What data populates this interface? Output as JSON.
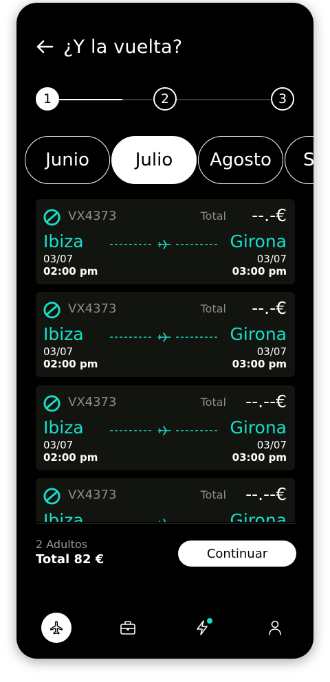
{
  "header": {
    "title": "¿Y la vuelta?",
    "back_icon": "arrow-left-icon"
  },
  "stepper": {
    "steps": [
      "1",
      "2",
      "3"
    ],
    "current_step": 1
  },
  "months": {
    "items": [
      "Junio",
      "Julio",
      "Agosto",
      "S"
    ],
    "selected": "Julio"
  },
  "flights": [
    {
      "code": "VX4373",
      "total_label": "Total",
      "price": "--.-€",
      "from": "Ibiza",
      "to": "Girona",
      "date_from": "03/07",
      "date_to": "03/07",
      "time_from": "02:00 pm",
      "time_to": "03:00 pm"
    },
    {
      "code": "VX4373",
      "total_label": "Total",
      "price": "--.-€",
      "from": "Ibiza",
      "to": "Girona",
      "date_from": "03/07",
      "date_to": "03/07",
      "time_from": "02:00 pm",
      "time_to": "03:00 pm"
    },
    {
      "code": "VX4373",
      "total_label": "Total",
      "price": "--.--€",
      "from": "Ibiza",
      "to": "Girona",
      "date_from": "03/07",
      "date_to": "03/07",
      "time_from": "02:00 pm",
      "time_to": "03:00 pm"
    },
    {
      "code": "VX4373",
      "total_label": "Total",
      "price": "--.--€",
      "from": "Ibiza",
      "to": "Girona",
      "date_from": "",
      "date_to": "",
      "time_from": "",
      "time_to": ""
    }
  ],
  "summary": {
    "passengers": "2 Adultos",
    "total": "Total 82 €",
    "continue_label": "Continuar"
  },
  "nav": {
    "items": [
      {
        "name": "flights",
        "icon": "plane-icon",
        "active": true
      },
      {
        "name": "trips",
        "icon": "briefcase-icon",
        "active": false
      },
      {
        "name": "offers",
        "icon": "lightning-icon",
        "active": false,
        "badge": true
      },
      {
        "name": "profile",
        "icon": "user-icon",
        "active": false
      }
    ]
  },
  "colors": {
    "accent": "#16e0c8",
    "background": "#000000",
    "card": "#121410"
  }
}
